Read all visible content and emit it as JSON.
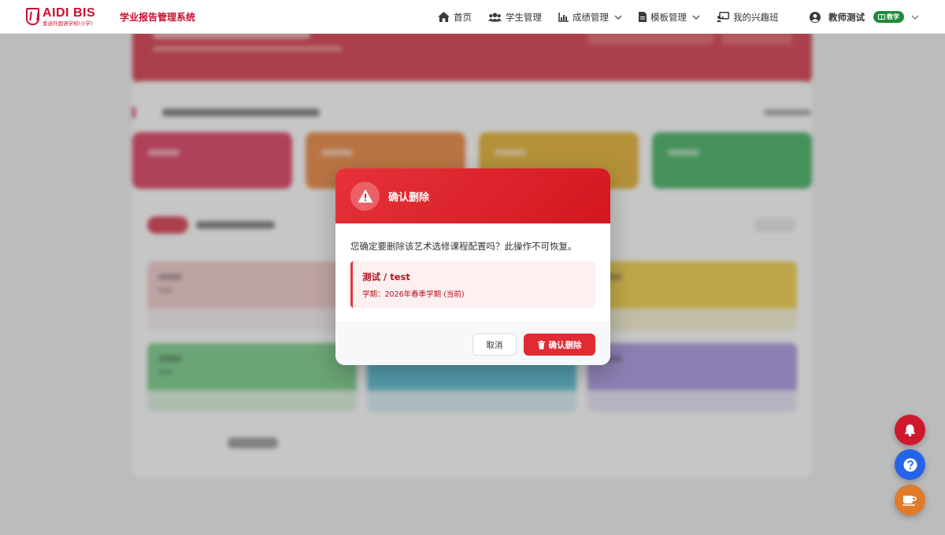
{
  "brand": {
    "logo_main": "AIDI BIS",
    "logo_sub": "爱迪外国语学校(小学)",
    "system_title": "学业报告管理系统"
  },
  "nav": {
    "items": [
      {
        "label": "首页",
        "icon": "home-icon"
      },
      {
        "label": "学生管理",
        "icon": "users-icon"
      },
      {
        "label": "成绩管理",
        "icon": "chart-icon",
        "dropdown": true
      },
      {
        "label": "模板管理",
        "icon": "file-icon",
        "dropdown": true
      },
      {
        "label": "我的兴趣班",
        "icon": "teacher-board-icon"
      }
    ]
  },
  "user": {
    "name": "教师测试",
    "role_badge": "教学"
  },
  "dialog": {
    "title": "确认删除",
    "message": "您确定要删除该艺术选修课程配置吗？此操作不可恢复。",
    "item_name": "测试 / test",
    "item_term": "学期：2026年春季学期 (当前)",
    "cancel_label": "取消",
    "confirm_label": "确认删除"
  },
  "colors": {
    "brand_red": "#c8102e",
    "danger": "#e12b33",
    "notify_fab": "#d0182c",
    "help_fab": "#2563eb",
    "coffee_fab": "#e07b2a"
  },
  "fabs": [
    {
      "icon": "bell-icon"
    },
    {
      "icon": "help-icon"
    },
    {
      "icon": "coffee-icon"
    }
  ]
}
